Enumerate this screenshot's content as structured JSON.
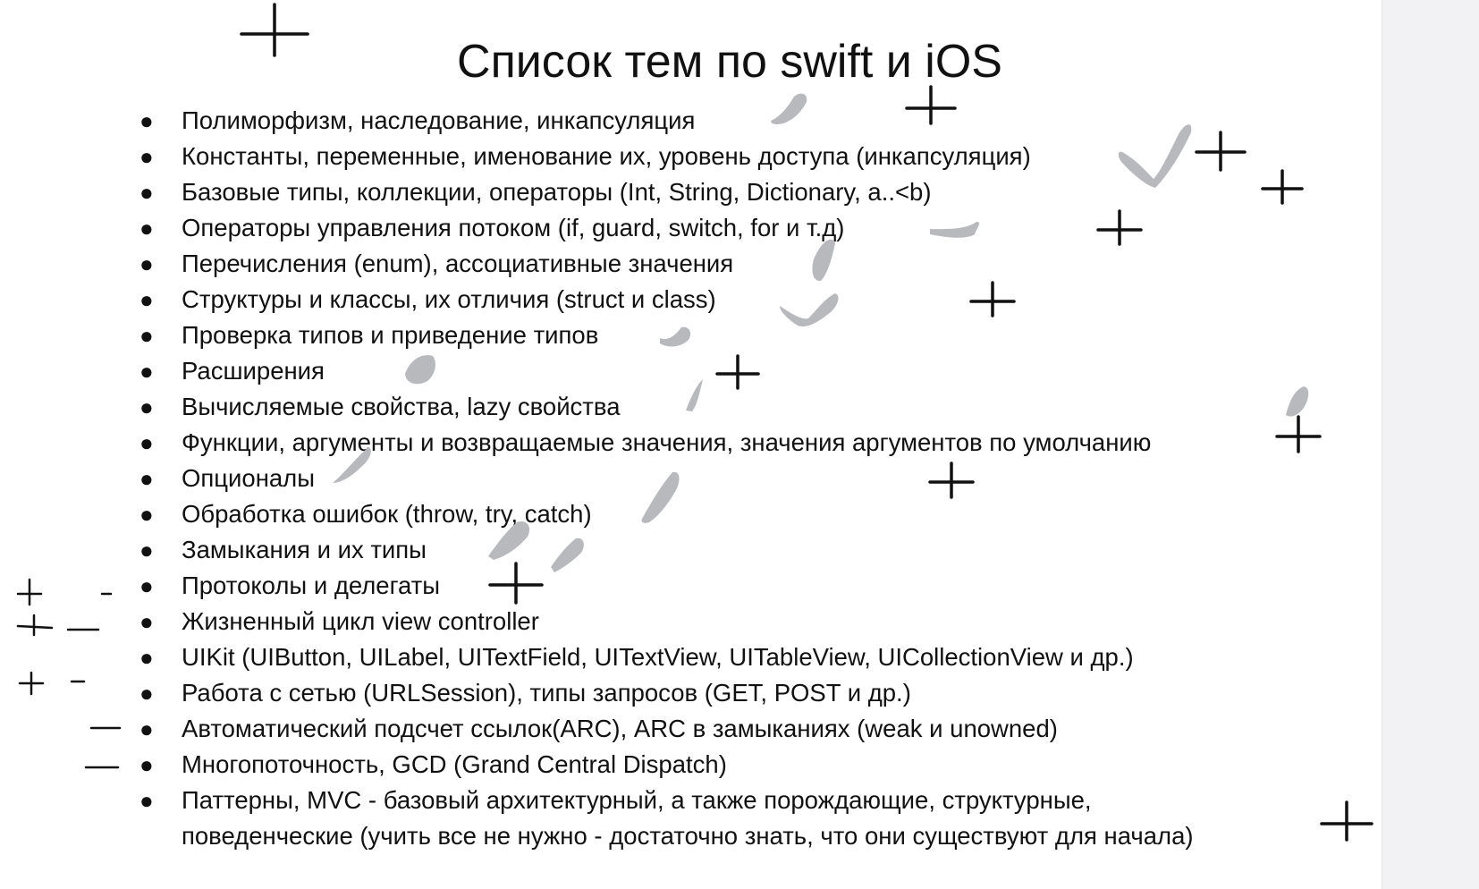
{
  "title": "Список тем по swift и iOS",
  "bullet_glyph": "●",
  "topics": [
    "Полиморфизм, наследование, инкапсуляция",
    "Константы, переменные, именование их, уровень доступа (инкапсуляция)",
    "Базовые типы, коллекции, операторы (Int, String, Dictionary, a..<b)",
    "Операторы управления потоком (if, guard, switch, for и т.д)",
    "Перечисления (enum), ассоциативные значения",
    "Структуры и классы, их отличия (struct и class)",
    "Проверка типов и приведение типов",
    "Расширения",
    "Вычисляемые свойства, lazy свойства",
    "Функции, аргументы и возвращаемые значения, значения аргументов по умолчанию",
    "Опционалы",
    "Обработка ошибок (throw, try, catch)",
    "Замыкания и их типы",
    "Протоколы и делегаты",
    "Жизненный цикл view controller",
    "UIKit (UIButton, UILabel, UITextField, UITextView, UITableView, UICollectionView  и др.)",
    "Работа с сетью (URLSession), типы запросов (GET, POST и др.)",
    "Автоматический подсчет ссылок(ARC), ARC в замыканиях (weak и unowned)",
    "Многопоточность, GCD (Grand Central Dispatch)",
    "Паттерны, MVC - базовый архитектурный, а также порождающие, структурные,",
    "поведенческие (учить все не нужно - достаточно знать, что они существуют для начала)"
  ],
  "colors": {
    "text": "#111111",
    "check_marks": "#b8b9bd",
    "plus_marks": "#111111",
    "gutter": "#f2f2f4"
  }
}
